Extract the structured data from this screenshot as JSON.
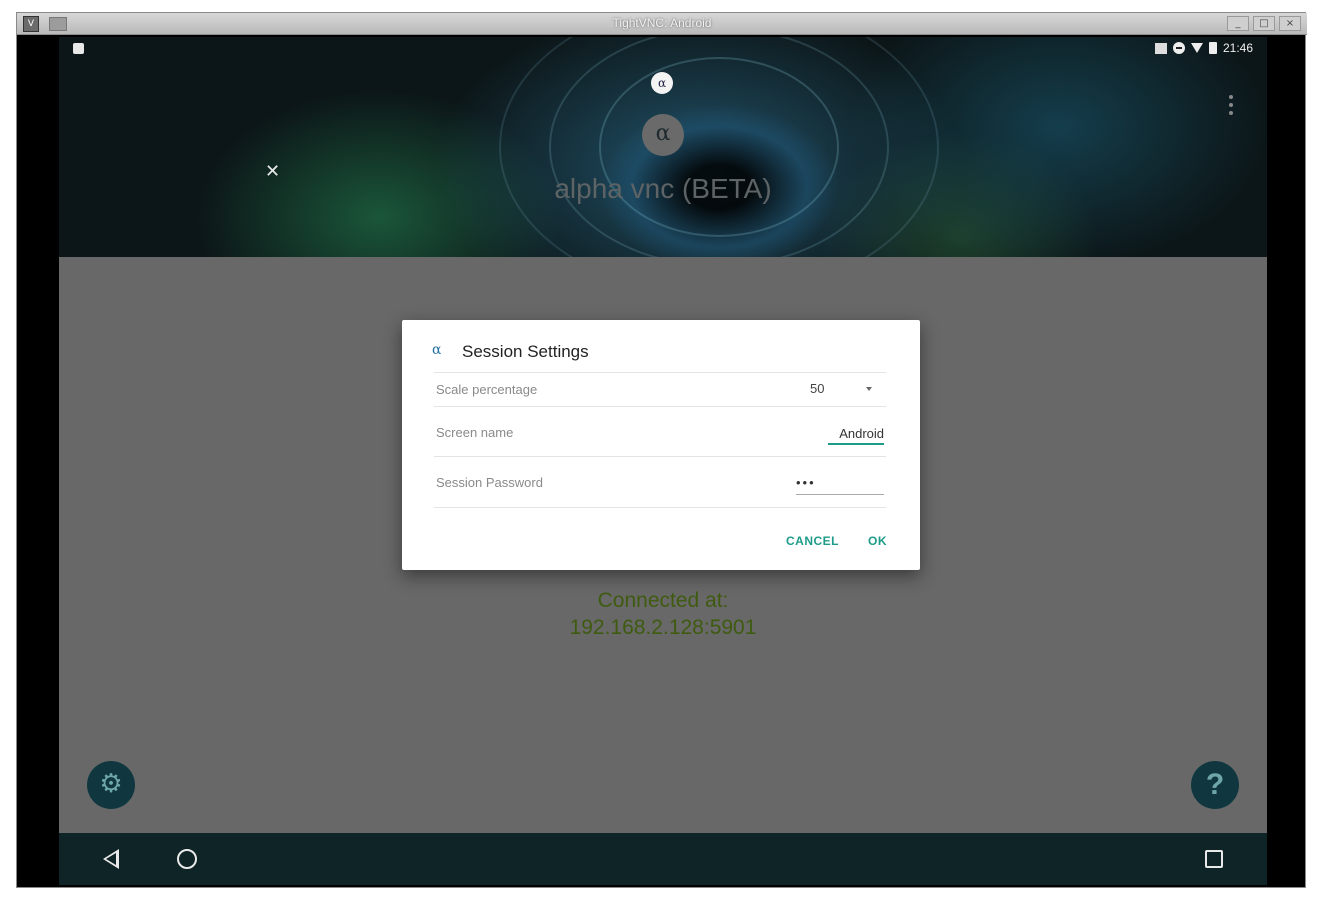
{
  "window": {
    "title": "TightVNC: Android",
    "controls": [
      "_",
      "□",
      "×"
    ]
  },
  "statusbar": {
    "time": "21:46",
    "icons": [
      "no-sim-icon",
      "do-not-disturb-icon",
      "wifi-icon",
      "battery-icon"
    ]
  },
  "header": {
    "app_title": "alpha vnc (BETA)",
    "logo_glyph": "α",
    "close_glyph": "✕"
  },
  "main": {
    "connected_line1": "Connected at:",
    "connected_line2": "192.168.2.128:5901"
  },
  "fab": {
    "settings_glyph": "⚙",
    "help_glyph": "?"
  },
  "dialog": {
    "icon_glyph": "α",
    "title": "Session Settings",
    "scale_label": "Scale percentage",
    "scale_value": "50",
    "screen_name_label": "Screen name",
    "screen_name_value": "Android",
    "password_label": "Session Password",
    "password_value": "•••",
    "cancel_label": "CANCEL",
    "ok_label": "OK"
  },
  "colors": {
    "accent": "#1e9c8a",
    "fab_bg": "#10373f",
    "connected_text": "#3f5b10",
    "content_bg": "#686868",
    "navbar_bg": "#0f2427"
  }
}
